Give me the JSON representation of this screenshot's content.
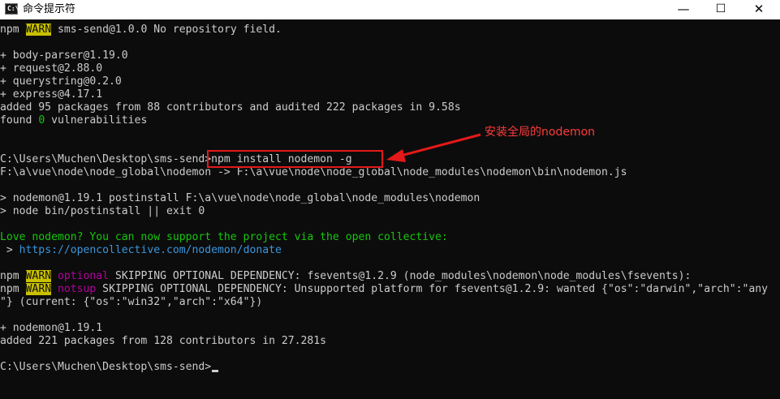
{
  "window": {
    "title": "命令提示符",
    "icon_label": "C:\\",
    "controls": {
      "minimize": "—",
      "maximize": "☐",
      "close": "✕"
    }
  },
  "terminal": {
    "l1": {
      "npm": "npm ",
      "warn": "WARN",
      "text": " sms-send@1.0.0 No repository field."
    },
    "l2": "+ body-parser@1.19.0",
    "l3": "+ request@2.88.0",
    "l4": "+ querystring@0.2.0",
    "l5": "+ express@4.17.1",
    "l6": "added 95 packages from 88 contributors and audited 222 packages in 9.58s",
    "l7": {
      "pre": "found ",
      "count": "0",
      "post": " vulnerabilities"
    },
    "l8": {
      "prompt": "C:\\Users\\Muchen\\Desktop\\sms-send>",
      "command": "npm install nodemon -g"
    },
    "l9": "F:\\a\\vue\\node\\node_global\\nodemon -> F:\\a\\vue\\node\\node_global\\node_modules\\nodemon\\bin\\nodemon.js",
    "l10": "> nodemon@1.19.1 postinstall F:\\a\\vue\\node\\node_global\\node_modules\\nodemon",
    "l11": "> node bin/postinstall || exit 0",
    "l12": "Love nodemon? You can now support the project via the open collective:",
    "l13": {
      "pre": " > ",
      "url": "https://opencollective.com/nodemon/donate"
    },
    "l14": {
      "npm": "npm ",
      "warn": "WARN",
      "tag": "optional",
      "text": " SKIPPING OPTIONAL DEPENDENCY: fsevents@1.2.9 (node_modules\\nodemon\\node_modules\\fsevents):"
    },
    "l15": {
      "npm": "npm ",
      "warn": "WARN",
      "tag": "notsup",
      "text": " SKIPPING OPTIONAL DEPENDENCY: Unsupported platform for fsevents@1.2.9: wanted {\"os\":\"darwin\",\"arch\":\"any"
    },
    "l16": "\"} (current: {\"os\":\"win32\",\"arch\":\"x64\"})",
    "l17": "+ nodemon@1.19.1",
    "l18": "added 221 packages from 128 contributors in 27.281s",
    "l19": {
      "prompt": "C:\\Users\\Muchen\\Desktop\\sms-send>"
    }
  },
  "annotation": {
    "text": "安装全局的nodemon",
    "color": "#ff3b3b"
  },
  "colors": {
    "background": "#0c0c0c",
    "text": "#cccccc",
    "warn_bg": "#c8c000",
    "magenta": "#b4009e",
    "green": "#16c60c",
    "cyan": "#3a96dd",
    "highlight": "#e41919"
  }
}
